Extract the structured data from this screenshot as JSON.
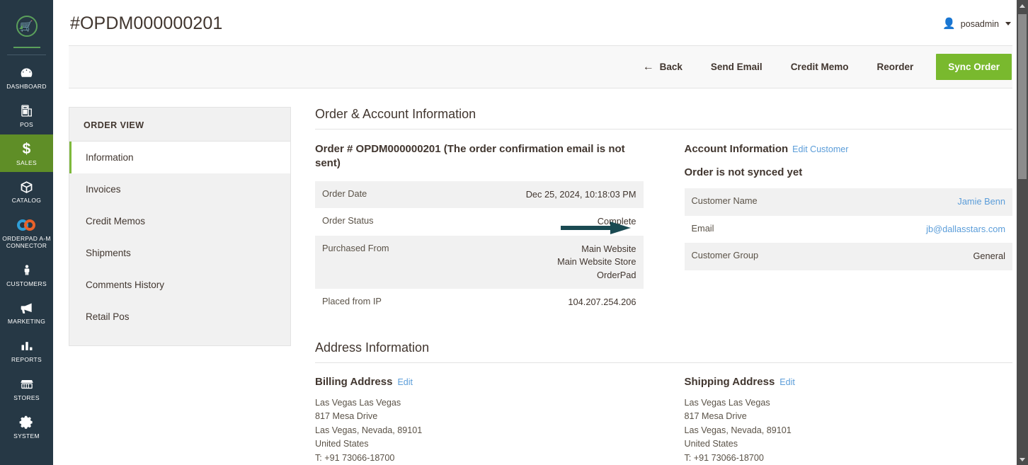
{
  "sidebar": {
    "logo_icon": "shopping-cart-refresh-icon",
    "items": [
      {
        "label": "DASHBOARD",
        "icon": "dashboard-gauge-icon",
        "active": false
      },
      {
        "label": "POS",
        "icon": "pos-terminal-icon",
        "active": false
      },
      {
        "label": "SALES",
        "icon": "dollar-sign-icon",
        "active": true
      },
      {
        "label": "CATALOG",
        "icon": "box-icon",
        "active": false
      },
      {
        "label": "ORDERPAD A-M CONNECTOR",
        "icon": "linked-rings-icon",
        "active": false
      },
      {
        "label": "CUSTOMERS",
        "icon": "person-icon",
        "active": false
      },
      {
        "label": "MARKETING",
        "icon": "megaphone-icon",
        "active": false
      },
      {
        "label": "REPORTS",
        "icon": "bar-chart-icon",
        "active": false
      },
      {
        "label": "STORES",
        "icon": "storefront-icon",
        "active": false
      },
      {
        "label": "SYSTEM",
        "icon": "gear-icon",
        "active": false
      }
    ]
  },
  "header": {
    "page_title": "#OPDM000000201",
    "admin_user": "posadmin",
    "admin_icon": "person-icon",
    "caret_icon": "chevron-down-icon"
  },
  "action_bar": {
    "back_icon": "arrow-left-icon",
    "buttons": [
      {
        "label": "Back",
        "primary": false
      },
      {
        "label": "Send Email",
        "primary": false
      },
      {
        "label": "Credit Memo",
        "primary": false
      },
      {
        "label": "Reorder",
        "primary": false
      },
      {
        "label": "Sync Order",
        "primary": true
      }
    ]
  },
  "order_view": {
    "title": "ORDER VIEW",
    "items": [
      {
        "label": "Information",
        "active": true
      },
      {
        "label": "Invoices",
        "active": false
      },
      {
        "label": "Credit Memos",
        "active": false
      },
      {
        "label": "Shipments",
        "active": false
      },
      {
        "label": "Comments History",
        "active": false
      },
      {
        "label": "Retail Pos",
        "active": false
      }
    ]
  },
  "order_account_section": {
    "section_title": "Order & Account Information",
    "order_block_title": "Order # OPDM000000201 (The order confirmation email is not sent)",
    "order_rows": [
      {
        "label": "Order Date",
        "value": "Dec 25, 2024, 10:18:03 PM"
      },
      {
        "label": "Order Status",
        "value": "Complete"
      },
      {
        "label": "Purchased From",
        "value": "Main Website\nMain Website Store\nOrderPad"
      },
      {
        "label": "Placed from IP",
        "value": "104.207.254.206"
      }
    ],
    "account_block_title": "Account Information",
    "account_edit_link": "Edit Customer",
    "sync_status": "Order is not synced yet",
    "account_rows": [
      {
        "label": "Customer Name",
        "value": "Jamie Benn",
        "is_link": true
      },
      {
        "label": "Email",
        "value": "jb@dallasstars.com",
        "is_link": true
      },
      {
        "label": "Customer Group",
        "value": "General",
        "is_link": false
      }
    ]
  },
  "address_section": {
    "section_title": "Address Information",
    "billing": {
      "title": "Billing Address",
      "edit_link": "Edit",
      "lines": "Las Vegas Las Vegas\n817 Mesa Drive\nLas Vegas, Nevada, 89101\nUnited States\nT: +91 73066-18700"
    },
    "shipping": {
      "title": "Shipping Address",
      "edit_link": "Edit",
      "lines": "Las Vegas Las Vegas\n817 Mesa Drive\nLas Vegas, Nevada, 89101\nUnited States\nT: +91 73066-18700"
    }
  },
  "annotation": {
    "arrow_color": "#1a4a52",
    "points_to": "Complete"
  },
  "colors": {
    "nav_background": "#263845",
    "nav_active": "#5f8e27",
    "primary_button": "#79b92e",
    "link": "#5b9dd9",
    "row_alt": "#f1f1f1",
    "text": "#41362f"
  },
  "scrollbar": {
    "up_icon": "triangle-up-icon",
    "down_icon": "triangle-down-icon"
  }
}
